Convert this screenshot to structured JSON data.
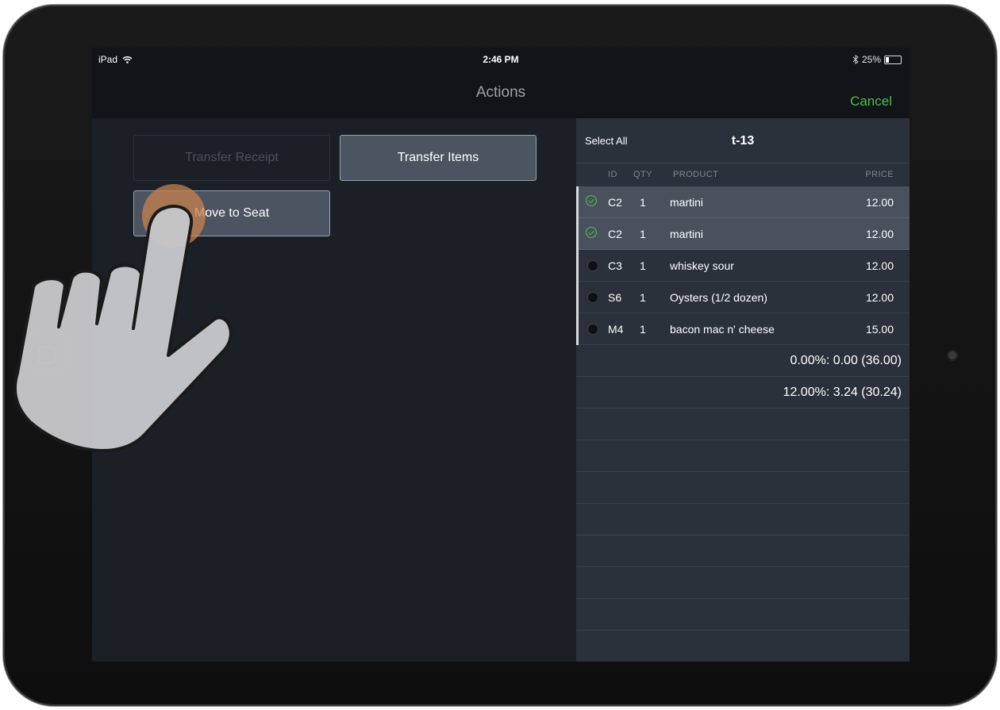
{
  "status_bar": {
    "device": "iPad",
    "time": "2:46 PM",
    "battery": "25%"
  },
  "nav": {
    "title": "Actions",
    "cancel_label": "Cancel"
  },
  "actions": {
    "transfer_receipt": "Transfer Receipt",
    "transfer_items": "Transfer Items",
    "move_to_seat": "Move to Seat"
  },
  "receipt": {
    "select_all": "Select All",
    "table_name": "t-13",
    "columns": {
      "id": "ID",
      "qty": "QTY",
      "product": "PRODUCT",
      "price": "PRICE"
    },
    "items": [
      {
        "id": "C2",
        "qty": "1",
        "product": "martini",
        "price": "12.00",
        "selected": true
      },
      {
        "id": "C2",
        "qty": "1",
        "product": "martini",
        "price": "12.00",
        "selected": true
      },
      {
        "id": "C3",
        "qty": "1",
        "product": "whiskey sour",
        "price": "12.00",
        "selected": false
      },
      {
        "id": "S6",
        "qty": "1",
        "product": "Oysters (1/2 dozen)",
        "price": "12.00",
        "selected": false
      },
      {
        "id": "M4",
        "qty": "1",
        "product": "bacon mac n' cheese",
        "price": "15.00",
        "selected": false
      }
    ],
    "taxes": [
      "0.00%: 0.00 (36.00)",
      "12.00%: 3.24 (30.24)"
    ]
  },
  "colors": {
    "accent_green": "#4bbf54",
    "button_fill": "#4d5461",
    "panel_bg": "#2b313a"
  },
  "icons": [
    "wifi-icon",
    "bluetooth-icon",
    "battery-icon",
    "check-circle-icon",
    "radio-icon",
    "tap-hand-icon",
    "home-button-icon"
  ]
}
